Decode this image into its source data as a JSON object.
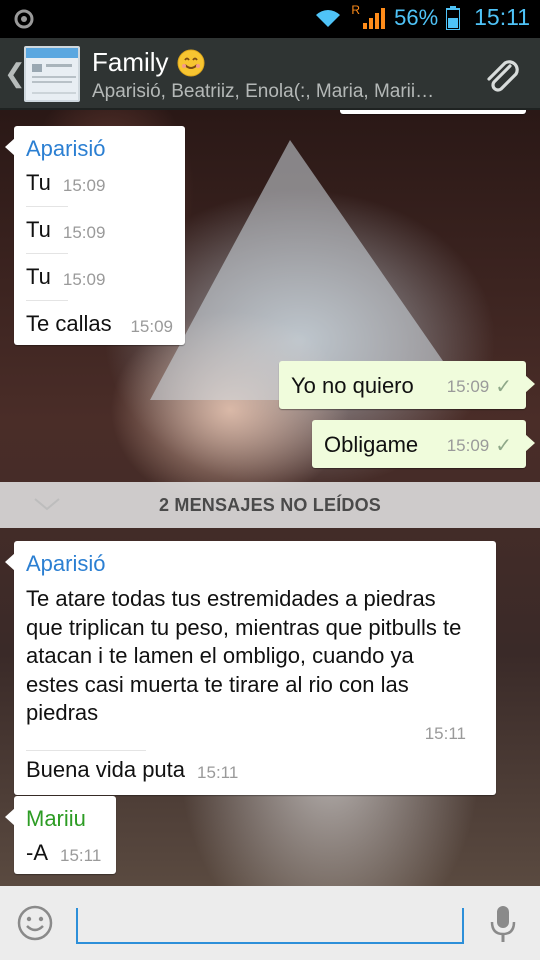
{
  "status_bar": {
    "roaming": "R",
    "battery": "56%",
    "time": "15:11",
    "color": "#4fc3f7"
  },
  "header": {
    "title": "Family",
    "subtitle": "Aparisió, Beatriiz, Enola(:, Maria, Marii…",
    "back_icon": "chevron-left-icon",
    "attach_icon": "paperclip-icon"
  },
  "messages_top": [
    {
      "direction": "in",
      "sender": "Aparisió",
      "lines": [
        {
          "text": "Tu",
          "time": "15:09"
        },
        {
          "text": "Tu",
          "time": "15:09"
        },
        {
          "text": "Tu",
          "time": "15:09"
        },
        {
          "text": "Te callas",
          "time": "15:09"
        }
      ]
    },
    {
      "direction": "out",
      "text": "Yo no quiero",
      "time": "15:09"
    },
    {
      "direction": "out",
      "text": "Obligame",
      "time": "15:09"
    }
  ],
  "unread_banner": "2 MENSAJES NO LEÍDOS",
  "messages_bottom": [
    {
      "direction": "in",
      "sender": "Aparisió",
      "lines": [
        {
          "text": "Te atare todas tus estremidades a piedras que triplican tu peso, mientras que pitbulls te atacan i te lamen el ombligo, cuando ya estes casi muerta te tirare al rio con las piedras",
          "time": "15:11"
        },
        {
          "text": "Buena vida puta",
          "time": "15:11"
        }
      ]
    },
    {
      "direction": "in",
      "sender": "Mariiu",
      "lines": [
        {
          "text": "-A",
          "time": "15:11"
        }
      ]
    }
  ],
  "input_bar": {
    "placeholder": "",
    "emoji_icon": "smiley-icon",
    "mic_icon": "microphone-icon"
  },
  "colors": {
    "sender_blue": "#2b7fd2",
    "sender_green": "#2d9c24",
    "outgoing_bubble": "#f0fcdc",
    "header_bg": "#2f3433"
  }
}
